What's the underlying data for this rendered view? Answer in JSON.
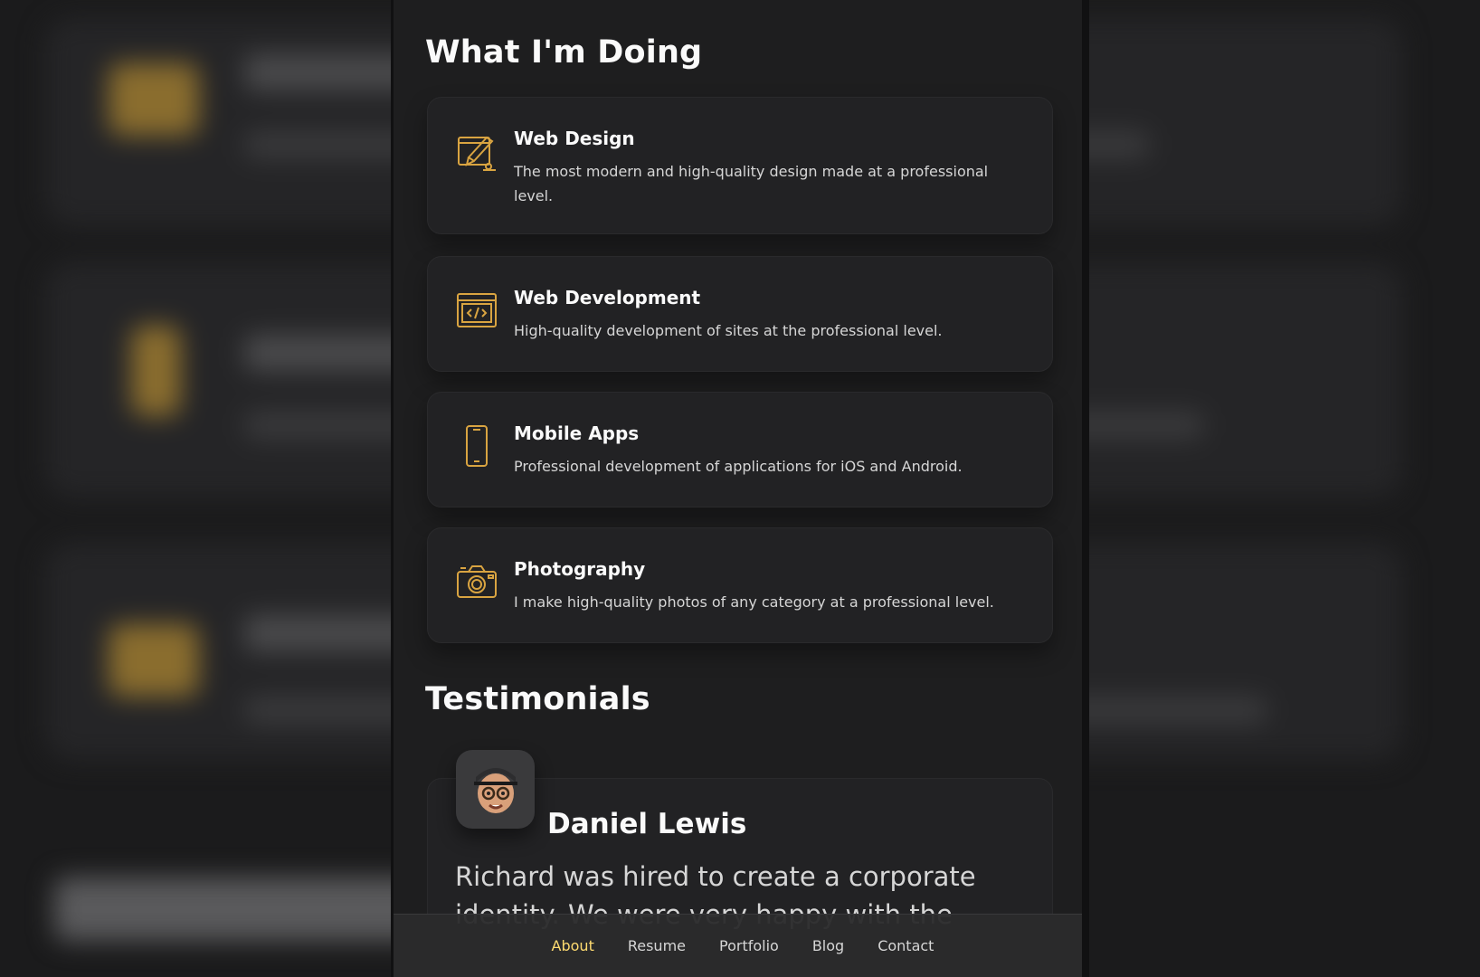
{
  "colors": {
    "accent": "#ffdb70",
    "icon_gold": "#d9a441",
    "panel_bg": "#1e1e1f",
    "card_bg": "#222224",
    "text_light": "#d6d6d6"
  },
  "services": {
    "title": "What I'm Doing",
    "items": [
      {
        "icon": "design-icon",
        "title": "Web Design",
        "text": "The most modern and high-quality design made at a professional level."
      },
      {
        "icon": "dev-icon",
        "title": "Web Development",
        "text": "High-quality development of sites at the professional level."
      },
      {
        "icon": "app-icon",
        "title": "Mobile Apps",
        "text": "Professional development of applications for iOS and Android."
      },
      {
        "icon": "camera-icon",
        "title": "Photography",
        "text": "I make high-quality photos of any category at a professional level."
      }
    ]
  },
  "testimonials": {
    "title": "Testimonials",
    "items": [
      {
        "name": "Daniel Lewis",
        "text": "Richard was hired to create a corporate identity. We were very happy with the"
      }
    ]
  },
  "navbar": {
    "items": [
      {
        "label": "About",
        "active": true
      },
      {
        "label": "Resume",
        "active": false
      },
      {
        "label": "Portfolio",
        "active": false
      },
      {
        "label": "Blog",
        "active": false
      },
      {
        "label": "Contact",
        "active": false
      }
    ]
  }
}
